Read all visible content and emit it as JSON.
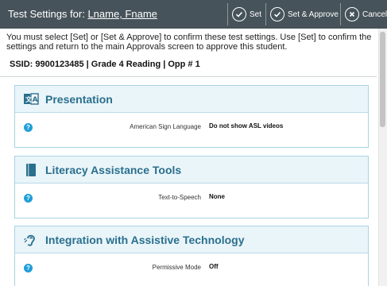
{
  "header": {
    "title_prefix": "Test Settings for:",
    "student_name": "Lname, Fname",
    "buttons": {
      "set": "Set",
      "set_approve": "Set & Approve",
      "cancel": "Cancel"
    },
    "colors": {
      "bar": "#47535a",
      "text": "#ffffff"
    }
  },
  "instructions": "You must select [Set] or [Set & Approve] to confirm these test settings. Use [Set] to confirm the settings and return to the main Approvals screen to approve this student.",
  "ssid_line": "SSID: 9900123485 | Grade 4 Reading | Opp # 1",
  "panels": [
    {
      "title": "Presentation",
      "icon": "presentation-icon",
      "rows": [
        {
          "label": "American Sign Language",
          "value": "Do not show ASL videos"
        }
      ]
    },
    {
      "title": "Literacy Assistance Tools",
      "icon": "book-icon",
      "rows": [
        {
          "label": "Text-to-Speech",
          "value": "None"
        }
      ]
    },
    {
      "title": "Integration with Assistive Technology",
      "icon": "ear-icon",
      "rows": [
        {
          "label": "Permissive Mode",
          "value": "Off"
        }
      ]
    }
  ],
  "help_glyph": "?",
  "colors": {
    "accent": "#2a6f8e",
    "panel_head": "#eaf5f9",
    "help": "#1f9ed8"
  }
}
